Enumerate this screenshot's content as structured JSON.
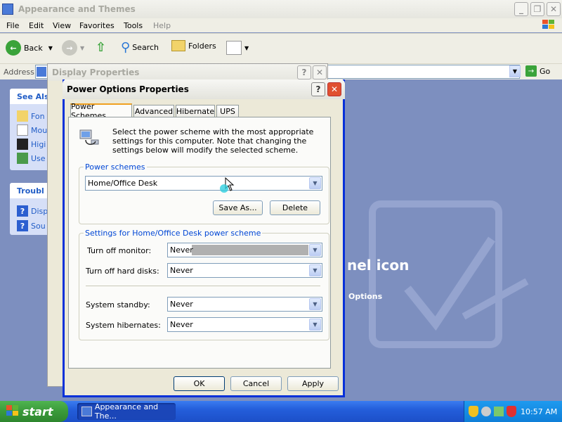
{
  "explorer": {
    "title": "Appearance and Themes",
    "menu": [
      "File",
      "Edit",
      "View",
      "Favorites",
      "Tools",
      "Help"
    ],
    "toolbar": {
      "back": "Back",
      "search": "Search",
      "folders": "Folders"
    },
    "address_label": "Address",
    "go_label": "Go",
    "side_panels": {
      "see_also_title": "See Als",
      "see_also_items": [
        "Fon",
        "Mou",
        "Higi",
        "Use"
      ],
      "trouble_title": "Troubl",
      "trouble_items": [
        "Disp",
        "Sou"
      ]
    },
    "background_fragments": {
      "icon_text": "nel icon",
      "options_text": "Options"
    }
  },
  "display_properties": {
    "title": "Display Properties"
  },
  "dialog": {
    "title": "Power Options Properties",
    "tabs": [
      "Power Schemes",
      "Advanced",
      "Hibernate",
      "UPS"
    ],
    "active_tab": "Power Schemes",
    "description": "Select the power scheme with the most appropriate settings for this computer. Note that changing the settings below will modify the selected scheme.",
    "schemes_group_label": "Power schemes",
    "scheme_selected": "Home/Office Desk",
    "save_as_label": "Save As...",
    "delete_label": "Delete",
    "settings_group_label": "Settings for Home/Office Desk power scheme",
    "settings": [
      {
        "label": "Turn off monitor:",
        "value": "Never"
      },
      {
        "label": "Turn off hard disks:",
        "value": "Never"
      },
      {
        "label": "System standby:",
        "value": "Never"
      },
      {
        "label": "System hibernates:",
        "value": "Never"
      }
    ],
    "ok_label": "OK",
    "cancel_label": "Cancel",
    "apply_label": "Apply"
  },
  "taskbar": {
    "start_label": "start",
    "task_label": "Appearance and The...",
    "clock": "10:57 AM"
  },
  "colors": {
    "desktop_blue": "#6b7db5",
    "xp_title_blue": "#0a5cd5",
    "start_green": "#3a9a3a",
    "taskbar_blue": "#245edb",
    "group_label_blue": "#0046d5"
  }
}
